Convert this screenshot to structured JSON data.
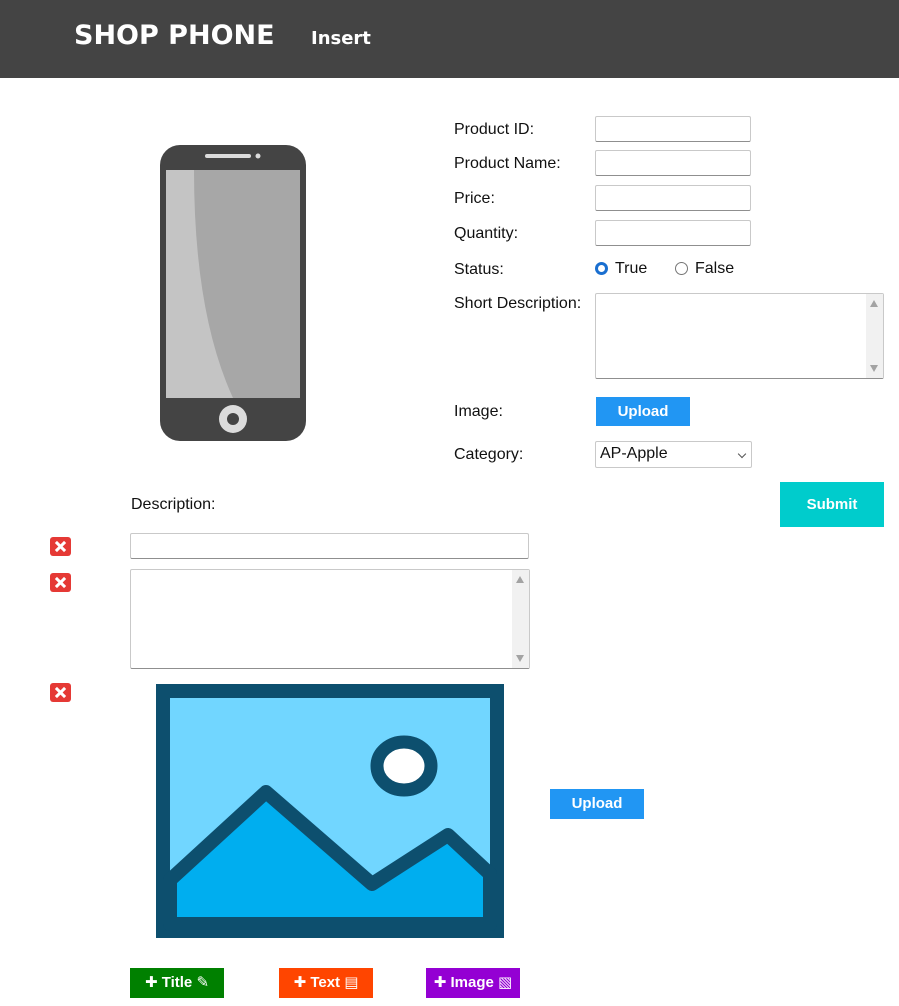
{
  "nav": {
    "brand": "SHOP PHONE",
    "insert": "Insert"
  },
  "form": {
    "product_id": {
      "label": "Product ID:",
      "value": ""
    },
    "product_name": {
      "label": "Product Name:",
      "value": ""
    },
    "price": {
      "label": "Price:",
      "value": ""
    },
    "quantity": {
      "label": "Quantity:",
      "value": ""
    },
    "status": {
      "label": "Status:",
      "options": [
        "True",
        "False"
      ],
      "selected": "True"
    },
    "short_description": {
      "label": "Short Description:",
      "value": ""
    },
    "image": {
      "label": "Image:",
      "upload_label": "Upload"
    },
    "category": {
      "label": "Category:",
      "selected": "AP-Apple"
    },
    "submit_label": "Submit"
  },
  "description": {
    "label": "Description:",
    "title_value": "",
    "text_value": "",
    "image_upload_label": "Upload"
  },
  "add_buttons": [
    {
      "label": "Title",
      "icon": "pencil-icon",
      "color": "#008000"
    },
    {
      "label": "Text",
      "icon": "document-icon",
      "color": "#ff4500"
    },
    {
      "label": "Image",
      "icon": "image-icon",
      "color": "#9400d3"
    }
  ],
  "colors": {
    "navbar": "#444444",
    "upload": "#2196f3",
    "submit": "#00cccc",
    "delete": "#e53935"
  }
}
